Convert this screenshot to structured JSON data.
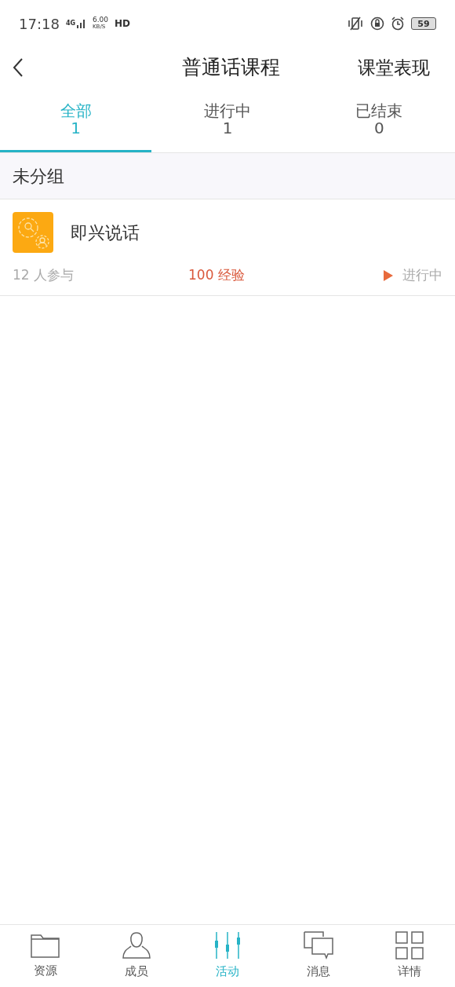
{
  "status_bar": {
    "time": "17:18",
    "network": "4G",
    "speed_value": "6.00",
    "speed_unit": "KB/S",
    "hd": "HD",
    "battery": "59"
  },
  "header": {
    "title": "普通话课程",
    "action": "课堂表现"
  },
  "tabs": [
    {
      "label": "全部",
      "count": "1",
      "selected": true
    },
    {
      "label": "进行中",
      "count": "1",
      "selected": false
    },
    {
      "label": "已结束",
      "count": "0",
      "selected": false
    }
  ],
  "group": {
    "title": "未分组"
  },
  "activities": [
    {
      "title": "即兴说话",
      "participants": "12 人参与",
      "points": "100 经验",
      "status": "进行中"
    }
  ],
  "bottom_nav": [
    {
      "label": "资源",
      "kind": "folder",
      "selected": false
    },
    {
      "label": "成员",
      "kind": "person",
      "selected": false
    },
    {
      "label": "活动",
      "kind": "sliders",
      "selected": true
    },
    {
      "label": "消息",
      "kind": "chat",
      "selected": false
    },
    {
      "label": "详情",
      "kind": "grid",
      "selected": false
    }
  ]
}
